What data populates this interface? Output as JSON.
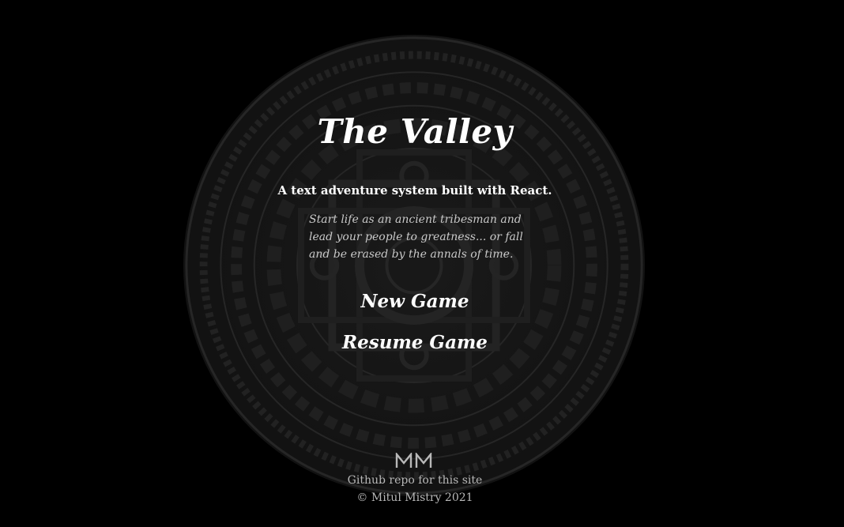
{
  "header": {
    "title": "The Valley",
    "subtitle": "A text adventure system built with React."
  },
  "intro": {
    "blurb": "Start life as an ancient tribesman and lead your people to greatness... or fall and be erased by the annals of time."
  },
  "menu": {
    "new_game_label": "New Game",
    "resume_game_label": "Resume Game"
  },
  "footer": {
    "logo_icon": "mm-logo-icon",
    "repo_link_label": "Github repo for this site",
    "copyright": "© Mitul Mistry 2021"
  },
  "background": {
    "decoration_icon": "mandala-background",
    "colors": {
      "page": "#000000",
      "mandala": "#1c1c1c",
      "title": "#ffffff",
      "muted": "#b8b8b8"
    }
  }
}
